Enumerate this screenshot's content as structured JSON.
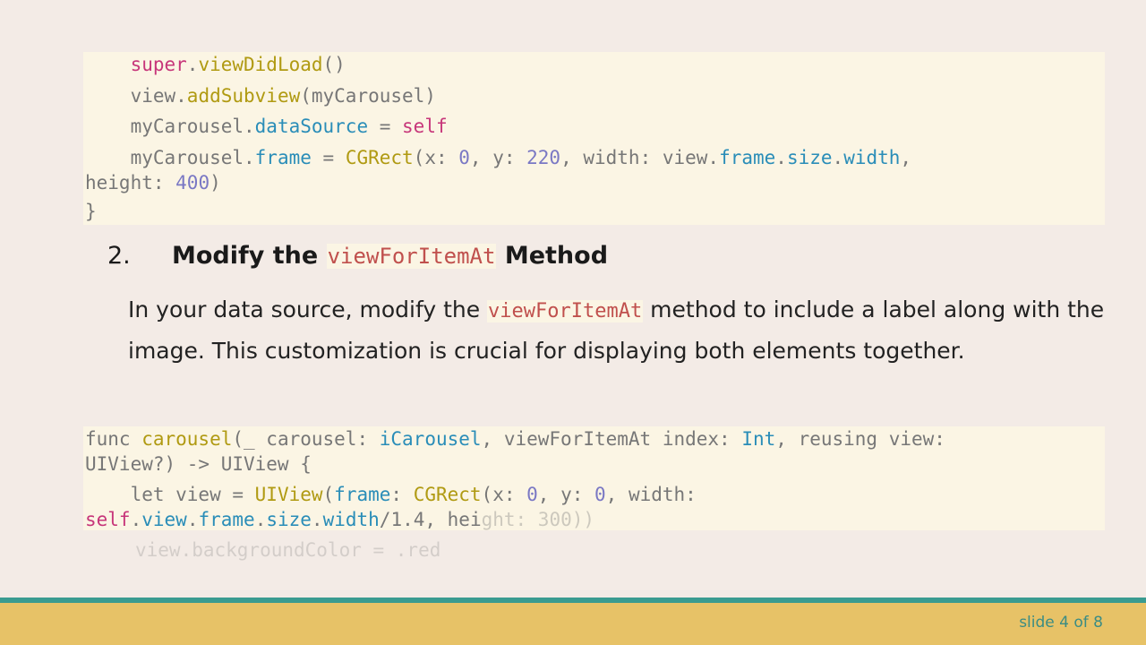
{
  "code_block_1": {
    "l1": {
      "a": "super",
      "b": ".",
      "c": "viewDidLoad",
      "d": "()"
    },
    "l2": {
      "a": "view.",
      "b": "addSubview",
      "c": "(myCarousel)"
    },
    "l3": {
      "a": "myCarousel.",
      "b": "dataSource",
      "c": " = ",
      "d": "self"
    },
    "l4": {
      "a": "myCarousel.",
      "b": "frame",
      "c": " = ",
      "d": "CGRect",
      "e": "(x: ",
      "f": "0",
      "g": ", y: ",
      "h": "220",
      "i": ", width: view.",
      "j": "frame",
      "k": ".",
      "l": "size",
      "m": ".",
      "n": "width",
      ",": ","
    },
    "l5": {
      "a": "height: ",
      "b": "400",
      "c": ")"
    },
    "l6": {
      "a": "}"
    }
  },
  "step": {
    "number": "2.",
    "title_before": "Modify the ",
    "title_code": "viewForItemAt",
    "title_after": " Method"
  },
  "paragraph": {
    "before": "In your data source, modify the ",
    "code": "viewForItemAt",
    "after": " method to include a label along with the image. This customization is crucial for displaying both elements together."
  },
  "code_block_2": {
    "l1": {
      "a": "func ",
      "b": "carousel",
      "c": "(_ carousel: ",
      "d": "iCarousel",
      "e": ", viewForItemAt index: ",
      "f": "Int",
      "g": ", reusing view:"
    },
    "l2": {
      "a": "UIView?) -> UIView {"
    },
    "l3": {
      "a": "let view = ",
      "b": "UIView",
      "c": "(",
      "d": "frame",
      "e": ": ",
      "f": "CGRect",
      "g": "(x: ",
      "h": "0",
      "i": ", y: ",
      "j": "0",
      "k": ", width:"
    },
    "l4": {
      "a": "self",
      "b": ".",
      "c": "view",
      "d": ".",
      "e": "frame",
      "f": ".",
      "g": "size",
      "h": ".",
      "i": "width",
      "j": "/1.4, hei",
      "k": "ght: 300))"
    },
    "l5": {
      "a": "view.backgroundColor = .red"
    }
  },
  "footer": {
    "slide_label": "slide 4 of 8"
  },
  "colors": {
    "footer_bg": "#e7c267",
    "footer_line": "#3a9b90",
    "code_bg": "#fbf5e4",
    "page_bg": "#f3ebe6"
  }
}
